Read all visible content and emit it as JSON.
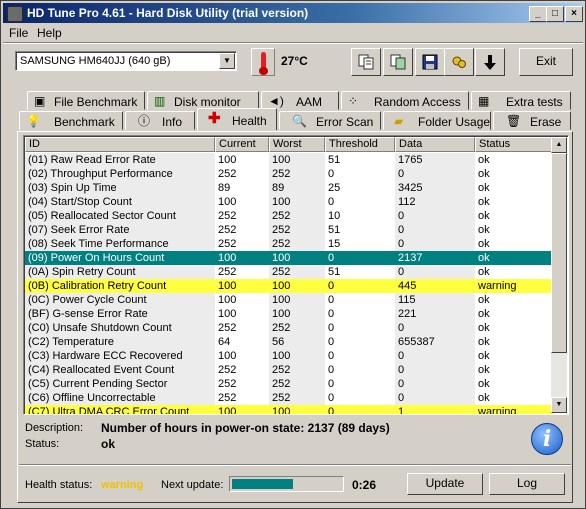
{
  "window": {
    "title": "HD Tune Pro 4.61 - Hard Disk Utility (trial version)"
  },
  "titlebar_buttons": {
    "minimize": "_",
    "maximize": "□",
    "close": "×"
  },
  "menu": {
    "file_label": "File",
    "help_label": "Help"
  },
  "toolbar": {
    "drive": "SAMSUNG HM640JJ (640 gB)",
    "temperature": "27°C",
    "icons": [
      "copy-text-icon",
      "copy-screenshot-icon",
      "save-icon",
      "options-icon",
      "down-arrow-icon"
    ],
    "exit_label": "Exit"
  },
  "tabs_top": [
    {
      "label": "File Benchmark",
      "icon": "file-benchmark-icon"
    },
    {
      "label": "Disk monitor",
      "icon": "disk-monitor-icon"
    },
    {
      "label": "AAM",
      "icon": "speaker-icon"
    },
    {
      "label": "Random Access",
      "icon": "random-access-icon"
    },
    {
      "label": "Extra tests",
      "icon": "extra-tests-icon"
    }
  ],
  "tabs_bottom": [
    {
      "label": "Benchmark",
      "icon": "lightbulb-icon"
    },
    {
      "label": "Info",
      "icon": "info-tab-icon"
    },
    {
      "label": "Health",
      "icon": "health-cross-icon"
    },
    {
      "label": "Error Scan",
      "icon": "magnifier-icon"
    },
    {
      "label": "Folder Usage",
      "icon": "folder-icon"
    },
    {
      "label": "Erase",
      "icon": "trash-icon"
    }
  ],
  "active_tab": "Health",
  "colors": {
    "selected_row": "#008080",
    "warning_row": "#ffff40",
    "warning_text": "#f0c000",
    "progress": "#008080"
  },
  "table": {
    "columns": [
      "ID",
      "Current",
      "Worst",
      "Threshold",
      "Data",
      "Status"
    ],
    "rows": [
      [
        "(01) Raw Read Error Rate",
        "100",
        "100",
        "51",
        "1765",
        "ok"
      ],
      [
        "(02) Throughput Performance",
        "252",
        "252",
        "0",
        "0",
        "ok"
      ],
      [
        "(03) Spin Up Time",
        "89",
        "89",
        "25",
        "3425",
        "ok"
      ],
      [
        "(04) Start/Stop Count",
        "100",
        "100",
        "0",
        "112",
        "ok"
      ],
      [
        "(05) Reallocated Sector Count",
        "252",
        "252",
        "10",
        "0",
        "ok"
      ],
      [
        "(07) Seek Error Rate",
        "252",
        "252",
        "51",
        "0",
        "ok"
      ],
      [
        "(08) Seek Time Performance",
        "252",
        "252",
        "15",
        "0",
        "ok"
      ],
      [
        "(09) Power On Hours Count",
        "100",
        "100",
        "0",
        "2137",
        "ok"
      ],
      [
        "(0A) Spin Retry Count",
        "252",
        "252",
        "51",
        "0",
        "ok"
      ],
      [
        "(0B) Calibration Retry Count",
        "100",
        "100",
        "0",
        "445",
        "warning"
      ],
      [
        "(0C) Power Cycle Count",
        "100",
        "100",
        "0",
        "115",
        "ok"
      ],
      [
        "(BF) G-sense Error Rate",
        "100",
        "100",
        "0",
        "221",
        "ok"
      ],
      [
        "(C0) Unsafe Shutdown Count",
        "252",
        "252",
        "0",
        "0",
        "ok"
      ],
      [
        "(C2) Temperature",
        "64",
        "56",
        "0",
        "655387",
        "ok"
      ],
      [
        "(C3) Hardware ECC Recovered",
        "100",
        "100",
        "0",
        "0",
        "ok"
      ],
      [
        "(C4) Reallocated Event Count",
        "252",
        "252",
        "0",
        "0",
        "ok"
      ],
      [
        "(C5) Current Pending Sector",
        "252",
        "252",
        "0",
        "0",
        "ok"
      ],
      [
        "(C6) Offline Uncorrectable",
        "252",
        "252",
        "0",
        "0",
        "ok"
      ],
      [
        "(C7) Ultra DMA CRC Error Count",
        "100",
        "100",
        "0",
        "1",
        "warning"
      ]
    ],
    "selected_row": 7
  },
  "details": {
    "description_label": "Description:",
    "description_value": "Number of hours in power-on state: 2137 (89 days)",
    "status_label": "Status:",
    "status_value": "ok"
  },
  "footer": {
    "health_label": "Health status:",
    "health_value": "warning",
    "next_update_label": "Next update:",
    "progress_fraction": 0.56,
    "countdown": "0:26",
    "update_label": "Update",
    "log_label": "Log"
  }
}
